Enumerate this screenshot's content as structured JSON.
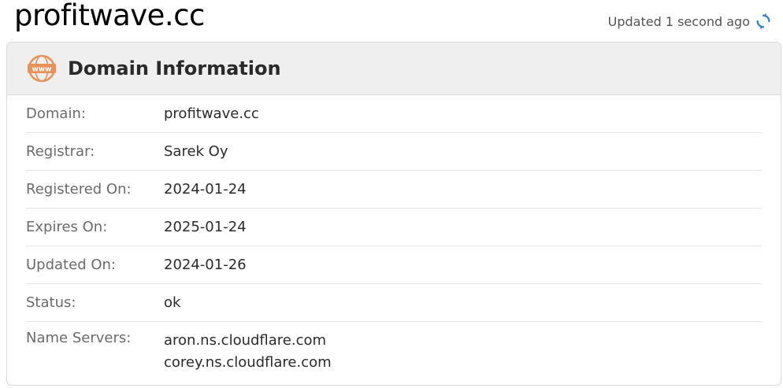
{
  "page_title": "profitwave.cc",
  "updated_text": "Updated 1 second ago",
  "card": {
    "title": "Domain Information",
    "icon": "www-icon"
  },
  "rows": [
    {
      "label": "Domain:",
      "value": "profitwave.cc"
    },
    {
      "label": "Registrar:",
      "value": "Sarek Oy"
    },
    {
      "label": "Registered On:",
      "value": "2024-01-24"
    },
    {
      "label": "Expires On:",
      "value": "2025-01-24"
    },
    {
      "label": "Updated On:",
      "value": "2024-01-26"
    },
    {
      "label": "Status:",
      "value": "ok"
    },
    {
      "label": "Name Servers:",
      "values": [
        "aron.ns.cloudflare.com",
        "corey.ns.cloudflare.com"
      ]
    }
  ],
  "colors": {
    "accent_icon": "#e8925a",
    "refresh_icon": "#3a86d4"
  }
}
